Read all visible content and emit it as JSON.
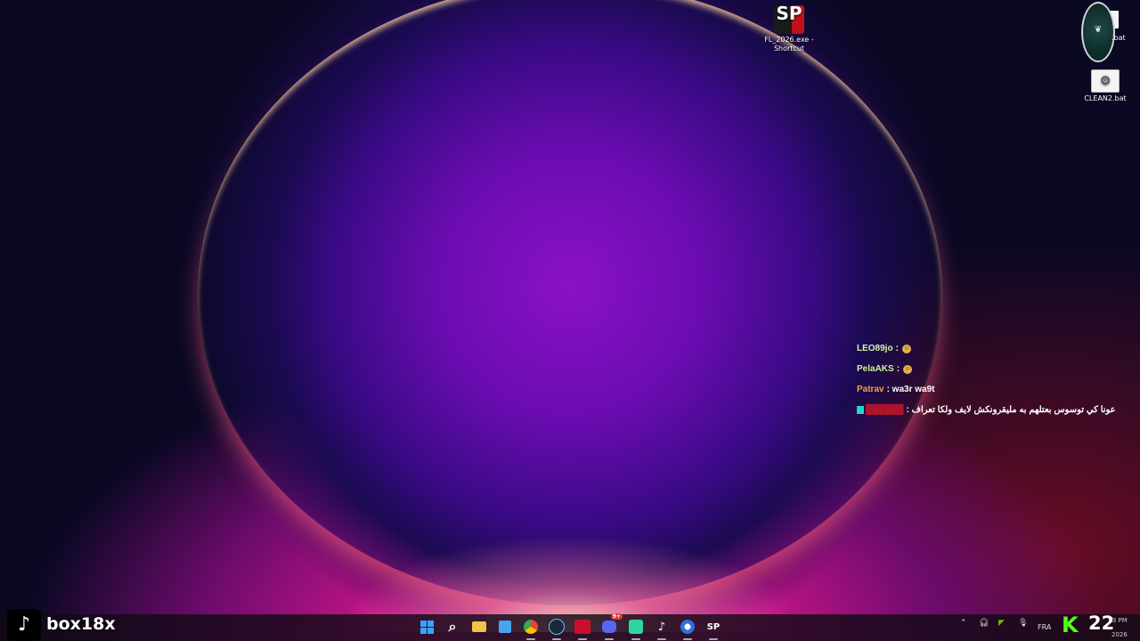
{
  "desktop": {
    "icons": [
      {
        "name": "fl-shortcut",
        "label_line1": "FL_2026.exe -",
        "label_line2": "Shortcut",
        "tile_text": "SP"
      },
      {
        "name": "bat-file",
        "label": ".bat"
      },
      {
        "name": "clean2-bat",
        "label": "CLEAN2.bat"
      }
    ]
  },
  "chat": {
    "messages": [
      {
        "user": "LEO89jo",
        "user_color": "#d6f5a8",
        "text": ":",
        "emoji": "face-emoji"
      },
      {
        "user": "PelaAKS",
        "user_color": "#c8f59a",
        "text": ":",
        "emoji": "face-emoji"
      },
      {
        "user": "Patrav",
        "user_color": "#f0a24a",
        "text": ": wa3r wa9t"
      },
      {
        "user": "",
        "user_color": "#b0142a",
        "text": ": عونا كي توسوس بعتلهم به مليقرونكش لايف ولكا تعراف"
      }
    ]
  },
  "stream_overlay": {
    "platform_logo": "tiktok-logo",
    "handle": "box18x",
    "kick_count": "22"
  },
  "taskbar": {
    "apps": [
      {
        "name": "start-button",
        "icon": "windows-icon"
      },
      {
        "name": "search-button",
        "icon": "search-icon",
        "glyph": "⌕"
      },
      {
        "name": "file-explorer",
        "icon": "folder-icon",
        "color": "#f2c14e"
      },
      {
        "name": "microsoft-store",
        "icon": "store-icon",
        "color": "#4aa3f0"
      },
      {
        "name": "chrome",
        "icon": "chrome-icon",
        "color": "#e94235"
      },
      {
        "name": "steam",
        "icon": "steam-icon",
        "color": "#1b2838"
      },
      {
        "name": "voicemeeter",
        "icon": "voicemeeter-icon",
        "color": "#c8102e"
      },
      {
        "name": "discord",
        "icon": "discord-icon",
        "color": "#5865f2",
        "badge": "9+"
      },
      {
        "name": "app-green",
        "icon": "app-icon",
        "color": "#2fd6a0"
      },
      {
        "name": "tiktok",
        "icon": "tiktok-icon",
        "color": "#000000"
      },
      {
        "name": "browser-blue",
        "icon": "browser-icon",
        "color": "#2f6fe0"
      },
      {
        "name": "sp-app",
        "icon": "sp-icon",
        "color": "#1a1a1a",
        "glyph": "SP"
      }
    ],
    "tray": {
      "language": "FRA",
      "time": "3 PM",
      "date": "2026"
    }
  }
}
